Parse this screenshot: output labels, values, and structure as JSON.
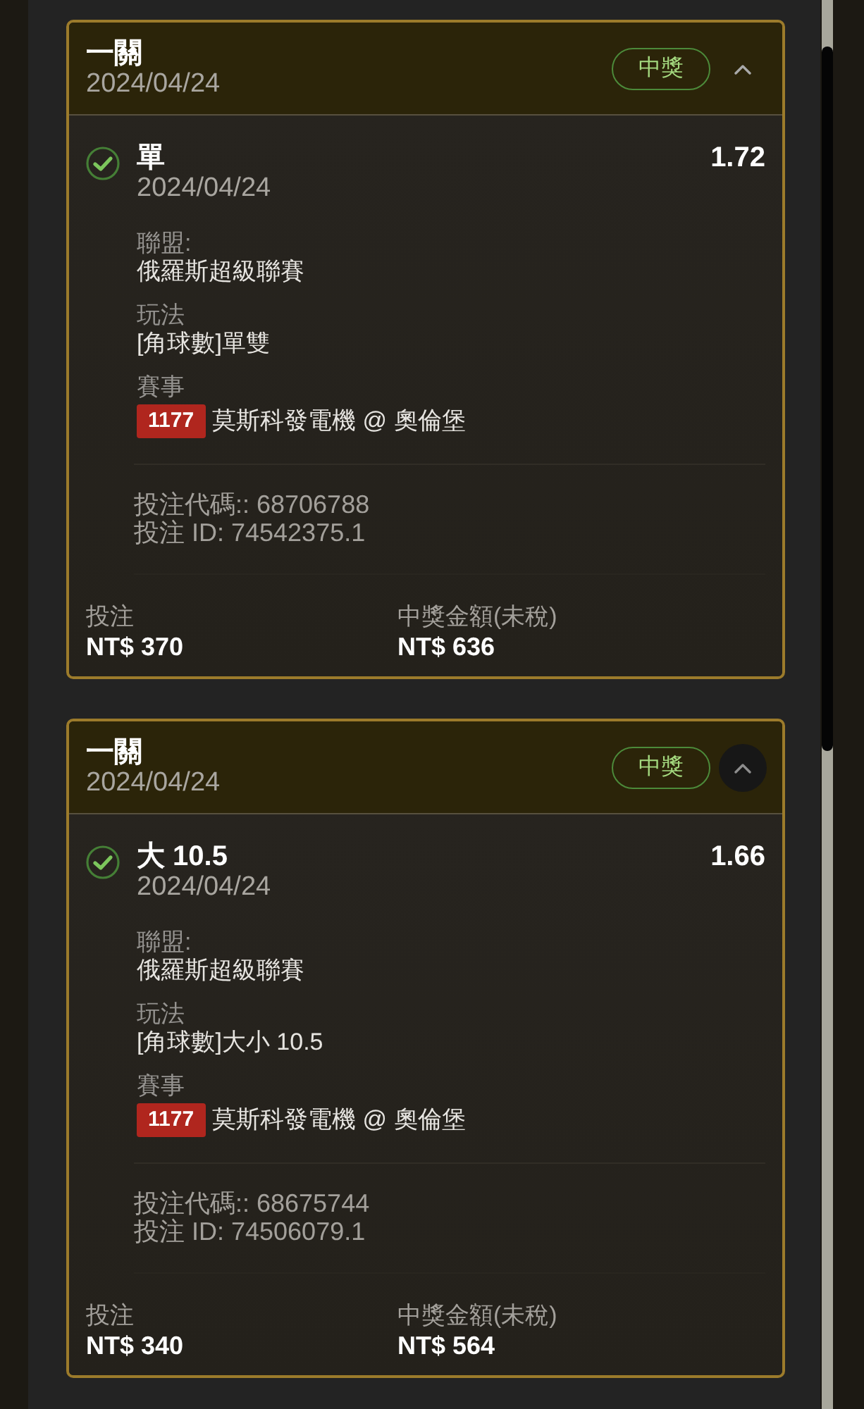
{
  "bets": [
    {
      "title": "一關",
      "date": "2024/04/24",
      "status": "中獎",
      "expanded": true,
      "toggle_focused": false,
      "selection": {
        "won": true,
        "pick": "單",
        "date": "2024/04/24",
        "odds": "1.72",
        "details": [
          {
            "kind": "text",
            "label": "聯盟:",
            "value": "俄羅斯超級聯賽"
          },
          {
            "kind": "text",
            "label": "玩法",
            "value": "[角球數]單雙"
          },
          {
            "kind": "match",
            "label": "賽事",
            "match_no": "1177",
            "value": "莫斯科發電機 @ 奧倫堡"
          }
        ],
        "codes": [
          "投注代碼:: 68706788",
          "投注 ID: 74542375.1"
        ]
      },
      "stake_label": "投注",
      "stake": "NT$ 370",
      "payout_label": "中獎金額(未稅)",
      "payout": "NT$ 636"
    },
    {
      "title": "一關",
      "date": "2024/04/24",
      "status": "中獎",
      "expanded": true,
      "toggle_focused": true,
      "selection": {
        "won": true,
        "pick": "大 10.5",
        "date": "2024/04/24",
        "odds": "1.66",
        "details": [
          {
            "kind": "text",
            "label": "聯盟:",
            "value": "俄羅斯超級聯賽"
          },
          {
            "kind": "text",
            "label": "玩法",
            "value": "[角球數]大小 10.5"
          },
          {
            "kind": "match",
            "label": "賽事",
            "match_no": "1177",
            "value": "莫斯科發電機 @ 奧倫堡"
          }
        ],
        "codes": [
          "投注代碼:: 68675744",
          "投注 ID: 74506079.1"
        ]
      },
      "stake_label": "投注",
      "stake": "NT$ 340",
      "payout_label": "中獎金額(未稅)",
      "payout": "NT$ 564"
    }
  ]
}
